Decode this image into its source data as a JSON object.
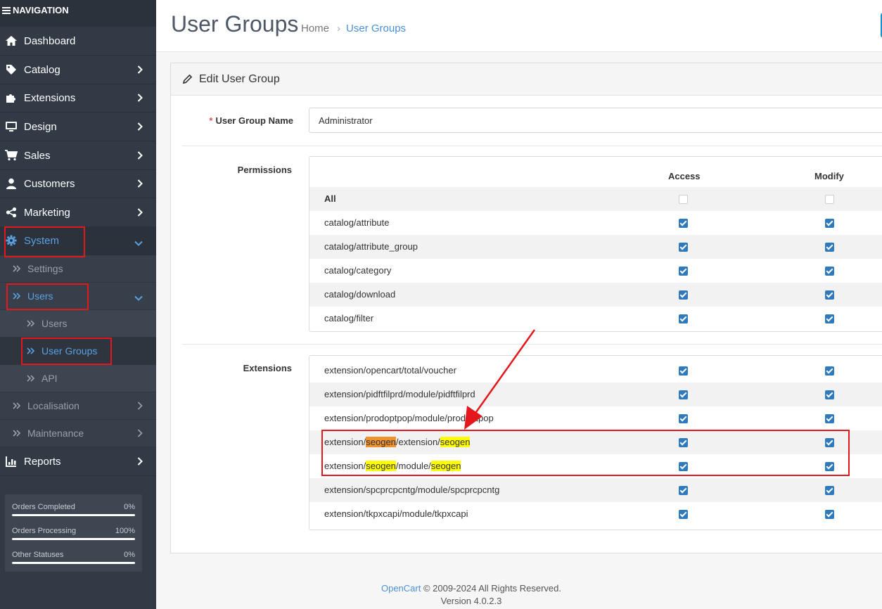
{
  "sidebar": {
    "header": "NAVIGATION",
    "menu": [
      {
        "label": "Dashboard"
      },
      {
        "label": "Catalog"
      },
      {
        "label": "Extensions"
      },
      {
        "label": "Design"
      },
      {
        "label": "Sales"
      },
      {
        "label": "Customers"
      },
      {
        "label": "Marketing"
      },
      {
        "label": "System"
      },
      {
        "label": "Reports"
      }
    ],
    "system_sub": {
      "settings": "Settings",
      "users": "Users",
      "users_sub": [
        "Users",
        "User Groups",
        "API"
      ],
      "localisation": "Localisation",
      "maintenance": "Maintenance"
    },
    "stats": [
      {
        "label": "Orders Completed",
        "value": "0%"
      },
      {
        "label": "Orders Processing",
        "value": "100%"
      },
      {
        "label": "Other Statuses",
        "value": "0%"
      }
    ]
  },
  "header": {
    "title": "User Groups",
    "breadcrumb": [
      "Home",
      "User Groups"
    ]
  },
  "card": {
    "title": "Edit User Group",
    "name_label": "User Group Name",
    "name_required": "*",
    "name_value": "Administrator",
    "permissions_label": "Permissions",
    "access_label": "Access",
    "modify_label": "Modify",
    "permissions_rows": [
      {
        "label": "All",
        "access": false,
        "modify": false
      },
      {
        "label": "catalog/attribute",
        "access": true,
        "modify": true
      },
      {
        "label": "catalog/attribute_group",
        "access": true,
        "modify": true
      },
      {
        "label": "catalog/category",
        "access": true,
        "modify": true
      },
      {
        "label": "catalog/download",
        "access": true,
        "modify": true
      },
      {
        "label": "catalog/filter",
        "access": true,
        "modify": true
      }
    ],
    "extensions_label": "Extensions",
    "extensions_rows": [
      {
        "label": "extension/opencart/total/voucher",
        "access": true,
        "modify": true
      },
      {
        "label": "extension/pidftfilprd/module/pidftfilprd",
        "access": true,
        "modify": true
      },
      {
        "label": "extension/prodoptpop/module/prodoptpop",
        "access": true,
        "modify": true
      },
      {
        "parts": [
          "extension/",
          "seogen",
          "/extension/",
          "seogen"
        ],
        "access": true,
        "modify": true
      },
      {
        "parts": [
          "extension/",
          "seogen",
          "/module/",
          "seogen"
        ],
        "access": true,
        "modify": true
      },
      {
        "label": "extension/spcprcpcntg/module/spcprcpcntg",
        "access": true,
        "modify": true
      },
      {
        "label": "extension/tkpxcapi/module/tkpxcapi",
        "access": true,
        "modify": true
      }
    ]
  },
  "footer": {
    "brand": "OpenCart",
    "copyright": "© 2009-2024 All Rights Reserved.",
    "version": "Version 4.0.2.3"
  },
  "colors": {
    "accent": "#4a90d9",
    "annotation": "#e4181c",
    "highlight_yellow": "#ffff00",
    "highlight_orange": "#f0922e"
  }
}
